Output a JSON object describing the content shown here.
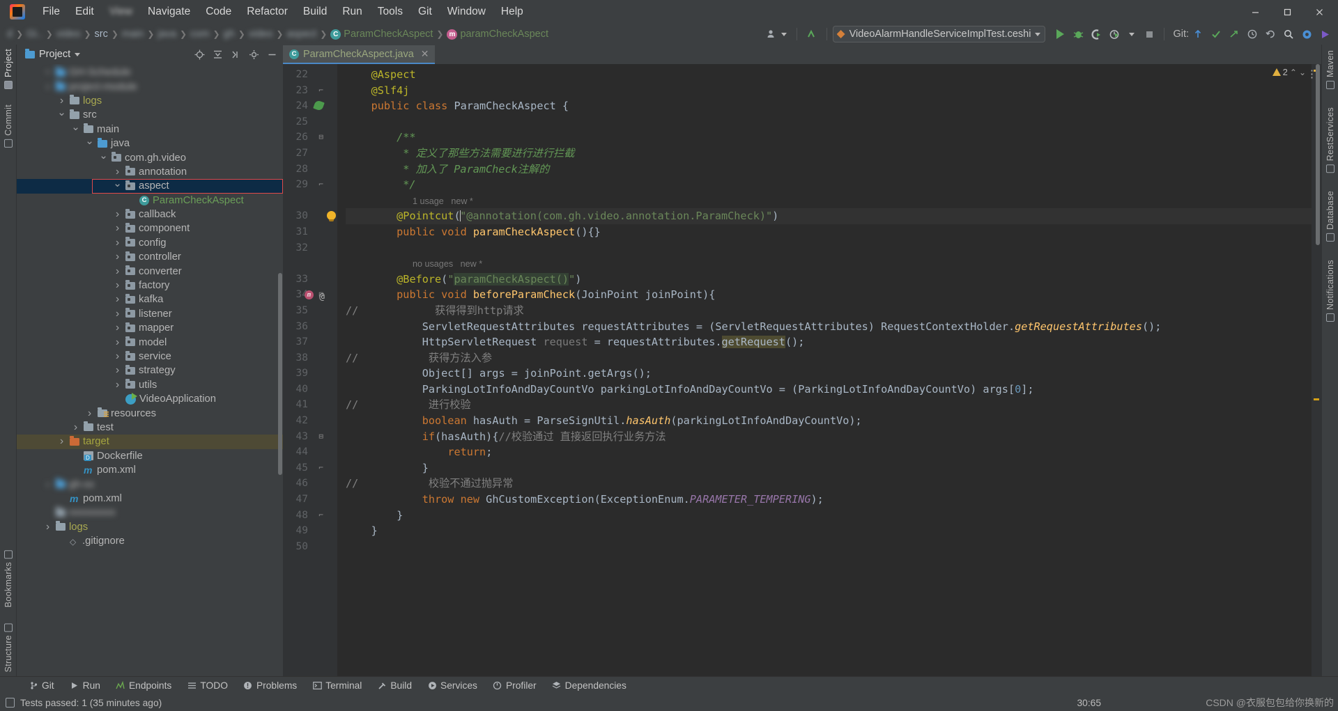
{
  "window": {
    "minimize": "—",
    "maximize": "▢",
    "close": "✕"
  },
  "menubar": {
    "items": [
      {
        "label": "File",
        "blurred": false
      },
      {
        "label": "Edit",
        "blurred": false
      },
      {
        "label": "View",
        "blurred": true
      },
      {
        "label": "Navigate",
        "blurred": false
      },
      {
        "label": "Code",
        "blurred": false
      },
      {
        "label": "Refactor",
        "blurred": false
      },
      {
        "label": "Build",
        "blurred": false
      },
      {
        "label": "Run",
        "blurred": false
      },
      {
        "label": "Tools",
        "blurred": false
      },
      {
        "label": "Git",
        "blurred": false
      },
      {
        "label": "Window",
        "blurred": false
      },
      {
        "label": "Help",
        "blurred": false
      }
    ]
  },
  "navbar": {
    "breadcrumbs": [
      {
        "label": "d",
        "blurred": true
      },
      {
        "label": "Gi..",
        "blurred": true
      },
      {
        "label": "video",
        "blurred": true
      },
      {
        "label": "src",
        "blurred": false
      },
      {
        "label": "main",
        "blurred": true
      },
      {
        "label": "java",
        "blurred": true
      },
      {
        "label": "com",
        "blurred": true
      },
      {
        "label": "gh",
        "blurred": true
      },
      {
        "label": "video",
        "blurred": true
      },
      {
        "label": "aspect",
        "blurred": true
      }
    ],
    "class_crumb": "ParamCheckAspect",
    "method_crumb": "paramCheckAspect",
    "run_config": "VideoAlarmHandleServiceImplTest.ceshi",
    "git_label": "Git:",
    "icons": {
      "profile": "user-group-icon",
      "back": "navigate-back-icon",
      "run": "run-icon",
      "debug": "debug-icon",
      "run_coverage": "run-with-coverage-icon",
      "profiler": "profiler-icon",
      "stop": "stop-icon",
      "git_update": "git-update-icon",
      "git_commit": "git-commit-icon",
      "git_push": "git-push-icon",
      "history": "history-icon",
      "undo": "undo-icon",
      "search": "search-icon",
      "settings": "settings-icon",
      "play_big": "play-icon"
    }
  },
  "left_rail": {
    "top": [
      {
        "label": "Project",
        "icon": "project-icon",
        "active": true
      },
      {
        "label": "Commit",
        "icon": "commit-icon",
        "active": false
      }
    ],
    "bottom": [
      {
        "label": "Bookmarks",
        "icon": "bookmarks-icon"
      },
      {
        "label": "Structure",
        "icon": "structure-icon"
      }
    ]
  },
  "right_rail": {
    "items": [
      {
        "label": "Maven",
        "icon": "maven-icon"
      },
      {
        "label": "RestServices",
        "icon": "rest-services-icon"
      },
      {
        "label": "Database",
        "icon": "database-icon"
      },
      {
        "label": "Notifications",
        "icon": "notifications-icon"
      }
    ]
  },
  "project_panel": {
    "title": "Project",
    "toolbar_icons": [
      "locate-icon",
      "collapse-all-icon",
      "expand-icon",
      "settings-icon",
      "hide-icon"
    ],
    "tree": [
      {
        "indent": 1,
        "arrow": "down",
        "icon": "module-icon",
        "label": "GH-Schedule",
        "style": "blur",
        "blurred": true
      },
      {
        "indent": 1,
        "arrow": "right",
        "icon": "module-icon",
        "label": "project-module",
        "style": "blur",
        "blurred": true
      },
      {
        "indent": 2,
        "arrow": "right",
        "icon": "folder",
        "label": "logs",
        "style": "yellowish"
      },
      {
        "indent": 2,
        "arrow": "down",
        "icon": "folder",
        "label": "src",
        "style": "plain"
      },
      {
        "indent": 3,
        "arrow": "down",
        "icon": "folder",
        "label": "main",
        "style": "plain"
      },
      {
        "indent": 4,
        "arrow": "down",
        "icon": "folder-blue",
        "label": "java",
        "style": "plain"
      },
      {
        "indent": 5,
        "arrow": "down",
        "icon": "package",
        "label": "com.gh.video",
        "style": "plain"
      },
      {
        "indent": 6,
        "arrow": "right",
        "icon": "package",
        "label": "annotation",
        "style": "plain"
      },
      {
        "indent": 6,
        "arrow": "down",
        "icon": "package",
        "label": "aspect",
        "style": "plain",
        "selected": "aspect"
      },
      {
        "indent": 7,
        "arrow": "none",
        "icon": "class",
        "label": "ParamCheckAspect",
        "style": "green"
      },
      {
        "indent": 6,
        "arrow": "right",
        "icon": "package",
        "label": "callback",
        "style": "plain"
      },
      {
        "indent": 6,
        "arrow": "right",
        "icon": "package",
        "label": "component",
        "style": "plain"
      },
      {
        "indent": 6,
        "arrow": "right",
        "icon": "package",
        "label": "config",
        "style": "plain"
      },
      {
        "indent": 6,
        "arrow": "right",
        "icon": "package",
        "label": "controller",
        "style": "plain"
      },
      {
        "indent": 6,
        "arrow": "right",
        "icon": "package",
        "label": "converter",
        "style": "plain"
      },
      {
        "indent": 6,
        "arrow": "right",
        "icon": "package",
        "label": "factory",
        "style": "plain"
      },
      {
        "indent": 6,
        "arrow": "right",
        "icon": "package",
        "label": "kafka",
        "style": "plain"
      },
      {
        "indent": 6,
        "arrow": "right",
        "icon": "package",
        "label": "listener",
        "style": "plain"
      },
      {
        "indent": 6,
        "arrow": "right",
        "icon": "package",
        "label": "mapper",
        "style": "plain"
      },
      {
        "indent": 6,
        "arrow": "right",
        "icon": "package",
        "label": "model",
        "style": "plain"
      },
      {
        "indent": 6,
        "arrow": "right",
        "icon": "package",
        "label": "service",
        "style": "plain"
      },
      {
        "indent": 6,
        "arrow": "right",
        "icon": "package",
        "label": "strategy",
        "style": "plain"
      },
      {
        "indent": 6,
        "arrow": "right",
        "icon": "package",
        "label": "utils",
        "style": "plain"
      },
      {
        "indent": 6,
        "arrow": "none",
        "icon": "spring",
        "label": "VideoApplication",
        "style": "plain"
      },
      {
        "indent": 4,
        "arrow": "right",
        "icon": "resources",
        "label": "resources",
        "style": "plain"
      },
      {
        "indent": 3,
        "arrow": "right",
        "icon": "folder",
        "label": "test",
        "style": "plain"
      },
      {
        "indent": 2,
        "arrow": "right",
        "icon": "folder-orange",
        "label": "target",
        "style": "olive",
        "selected": "target"
      },
      {
        "indent": 3,
        "arrow": "none",
        "icon": "docker",
        "label": "Dockerfile",
        "style": "plain"
      },
      {
        "indent": 3,
        "arrow": "none",
        "icon": "maven",
        "label": "pom.xml",
        "style": "plain"
      },
      {
        "indent": 1,
        "arrow": "right",
        "icon": "module-icon",
        "label": "gh-xx",
        "style": "blur",
        "blurred": true
      },
      {
        "indent": 2,
        "arrow": "none",
        "icon": "maven",
        "label": "pom.xml",
        "style": "plain"
      },
      {
        "indent": 1,
        "arrow": "none",
        "icon": "blurmod",
        "label": "xxxxxxxxx",
        "style": "blur",
        "blurred": true
      },
      {
        "indent": 1,
        "arrow": "right",
        "icon": "folder",
        "label": "logs",
        "style": "yellowish"
      },
      {
        "indent": 2,
        "arrow": "none",
        "icon": "git",
        "label": ".gitignore",
        "style": "plain"
      }
    ]
  },
  "editor": {
    "tab": {
      "label": "ParamCheckAspect.java",
      "icon": "java-class-icon",
      "close": "✕"
    },
    "warning_count": "2",
    "first_line": 22,
    "caret_position": "30:65",
    "lines": [
      {
        "n": 22,
        "fold": "",
        "gutter": "",
        "tokens": [
          {
            "t": "    ",
            "c": "txt"
          },
          {
            "t": "@Aspect",
            "c": "ann"
          }
        ]
      },
      {
        "n": 23,
        "fold": "end-brace",
        "gutter": "",
        "tokens": [
          {
            "t": "    ",
            "c": "txt"
          },
          {
            "t": "@Slf4j",
            "c": "ann"
          }
        ]
      },
      {
        "n": 24,
        "fold": "",
        "gutter": "bean",
        "tokens": [
          {
            "t": "    ",
            "c": "txt"
          },
          {
            "t": "public class ",
            "c": "kw"
          },
          {
            "t": "ParamCheckAspect ",
            "c": "txt"
          },
          {
            "t": "{",
            "c": "txt"
          }
        ]
      },
      {
        "n": 25,
        "fold": "",
        "gutter": "",
        "tokens": []
      },
      {
        "n": 26,
        "fold": "start",
        "gutter": "",
        "tokens": [
          {
            "t": "        /**",
            "c": "cmt"
          }
        ]
      },
      {
        "n": 27,
        "fold": "",
        "gutter": "",
        "tokens": [
          {
            "t": "         * 定义了那些方法需要进行进行拦截",
            "c": "cmt"
          }
        ]
      },
      {
        "n": 28,
        "fold": "",
        "gutter": "",
        "tokens": [
          {
            "t": "         * 加入了 ParamCheck注解的",
            "c": "cmt"
          }
        ]
      },
      {
        "n": 29,
        "fold": "end",
        "gutter": "",
        "tokens": [
          {
            "t": "         */",
            "c": "cmt"
          }
        ]
      },
      {
        "n": "",
        "fold": "",
        "gutter": "",
        "hint": "1 usage   new *"
      },
      {
        "n": 30,
        "fold": "",
        "gutter": "bulb",
        "highlight": true,
        "tokens": [
          {
            "t": "        ",
            "c": "txt"
          },
          {
            "t": "@Pointcut",
            "c": "ann"
          },
          {
            "t": "(",
            "c": "txt"
          },
          {
            "t": "|",
            "c": "caret"
          },
          {
            "t": "\"@annotation(com.gh.video.annotation.ParamCheck)\"",
            "c": "str"
          },
          {
            "t": ")",
            "c": "txt"
          }
        ]
      },
      {
        "n": 31,
        "fold": "",
        "gutter": "",
        "tokens": [
          {
            "t": "        ",
            "c": "txt"
          },
          {
            "t": "public void ",
            "c": "kw"
          },
          {
            "t": "paramCheckAspect",
            "c": "meth"
          },
          {
            "t": "(){}",
            "c": "txt"
          }
        ]
      },
      {
        "n": 32,
        "fold": "",
        "gutter": "",
        "tokens": []
      },
      {
        "n": "",
        "fold": "",
        "gutter": "",
        "hint": "no usages   new *"
      },
      {
        "n": 33,
        "fold": "",
        "gutter": "",
        "tokens": [
          {
            "t": "        ",
            "c": "txt"
          },
          {
            "t": "@Before",
            "c": "ann"
          },
          {
            "t": "(",
            "c": "txt"
          },
          {
            "t": "\"",
            "c": "str"
          },
          {
            "t": "paramCheckAspect()",
            "c": "str sel-g"
          },
          {
            "t": "\"",
            "c": "str"
          },
          {
            "t": ")",
            "c": "txt"
          }
        ]
      },
      {
        "n": 34,
        "fold": "start",
        "gutter": "method-override",
        "tokens": [
          {
            "t": "        ",
            "c": "txt"
          },
          {
            "t": "public void ",
            "c": "kw"
          },
          {
            "t": "beforeParamCheck",
            "c": "meth"
          },
          {
            "t": "(",
            "c": "txt"
          },
          {
            "t": "JoinPoint joinPoint",
            "c": "txt"
          },
          {
            "t": "){",
            "c": "txt"
          }
        ]
      },
      {
        "n": 35,
        "fold": "",
        "gutter": "",
        "comment_slash": true,
        "tokens": [
          {
            "t": "            获得得到http请求",
            "c": "lcmt"
          }
        ]
      },
      {
        "n": 36,
        "fold": "",
        "gutter": "",
        "tokens": [
          {
            "t": "            ServletRequestAttributes requestAttributes = (ServletRequestAttributes) RequestContextHolder.",
            "c": "txt"
          },
          {
            "t": "getRequestAttributes",
            "c": "smeth"
          },
          {
            "t": "();",
            "c": "txt"
          }
        ]
      },
      {
        "n": 37,
        "fold": "",
        "gutter": "",
        "tokens": [
          {
            "t": "            HttpServletRequest ",
            "c": "txt"
          },
          {
            "t": "request",
            "c": "par"
          },
          {
            "t": " = requestAttributes.",
            "c": "txt"
          },
          {
            "t": "getRequest",
            "c": "txt sel-y"
          },
          {
            "t": "()",
            "c": "txt"
          },
          {
            "t": ";",
            "c": "txt"
          }
        ]
      },
      {
        "n": 38,
        "fold": "",
        "gutter": "",
        "comment_slash": true,
        "tokens": [
          {
            "t": "           获得方法入参",
            "c": "lcmt"
          }
        ]
      },
      {
        "n": 39,
        "fold": "",
        "gutter": "",
        "tokens": [
          {
            "t": "            Object[] args = joinPoint.getArgs",
            "c": "txt"
          },
          {
            "t": "();",
            "c": "txt"
          }
        ]
      },
      {
        "n": 40,
        "fold": "",
        "gutter": "",
        "tokens": [
          {
            "t": "            ParkingLotInfoAndDayCountVo parkingLotInfoAndDayCountVo = (ParkingLotInfoAndDayCountVo) args[",
            "c": "txt"
          },
          {
            "t": "0",
            "c": "num"
          },
          {
            "t": "];",
            "c": "txt"
          }
        ]
      },
      {
        "n": 41,
        "fold": "",
        "gutter": "",
        "comment_slash": true,
        "tokens": [
          {
            "t": "           进行校验",
            "c": "lcmt"
          }
        ]
      },
      {
        "n": 42,
        "fold": "",
        "gutter": "",
        "tokens": [
          {
            "t": "            ",
            "c": "txt"
          },
          {
            "t": "boolean ",
            "c": "kw"
          },
          {
            "t": "hasAuth = ParseSignUtil.",
            "c": "txt"
          },
          {
            "t": "hasAuth",
            "c": "smeth"
          },
          {
            "t": "(parkingLotInfoAndDayCountVo);",
            "c": "txt"
          }
        ]
      },
      {
        "n": 43,
        "fold": "start",
        "gutter": "",
        "tokens": [
          {
            "t": "            ",
            "c": "txt"
          },
          {
            "t": "if",
            "c": "kw"
          },
          {
            "t": "(hasAuth){",
            "c": "txt"
          },
          {
            "t": "//校验通过 直接返回执行业务方法",
            "c": "lcmt"
          }
        ]
      },
      {
        "n": 44,
        "fold": "",
        "gutter": "",
        "tokens": [
          {
            "t": "                ",
            "c": "txt"
          },
          {
            "t": "return",
            "c": "kw"
          },
          {
            "t": ";",
            "c": "txt"
          }
        ]
      },
      {
        "n": 45,
        "fold": "end",
        "gutter": "",
        "tokens": [
          {
            "t": "            }",
            "c": "txt"
          }
        ]
      },
      {
        "n": 46,
        "fold": "",
        "gutter": "",
        "comment_slash": true,
        "tokens": [
          {
            "t": "           校验不通过抛异常",
            "c": "lcmt"
          }
        ]
      },
      {
        "n": 47,
        "fold": "",
        "gutter": "",
        "tokens": [
          {
            "t": "            ",
            "c": "txt"
          },
          {
            "t": "throw new ",
            "c": "kw"
          },
          {
            "t": "GhCustomException(ExceptionEnum.",
            "c": "txt"
          },
          {
            "t": "PARAMETER_TEMPERING",
            "c": "sfield"
          },
          {
            "t": ");",
            "c": "txt"
          }
        ]
      },
      {
        "n": 48,
        "fold": "end",
        "gutter": "",
        "tokens": [
          {
            "t": "        }",
            "c": "txt"
          }
        ]
      },
      {
        "n": 49,
        "fold": "",
        "gutter": "",
        "tokens": [
          {
            "t": "    }",
            "c": "txt"
          }
        ]
      },
      {
        "n": 50,
        "fold": "",
        "gutter": "",
        "tokens": []
      }
    ]
  },
  "toolwindows": [
    {
      "label": "Git",
      "icon": "git-branch-icon"
    },
    {
      "label": "Run",
      "icon": "run-icon"
    },
    {
      "label": "Endpoints",
      "icon": "endpoints-icon"
    },
    {
      "label": "TODO",
      "icon": "todo-list-icon"
    },
    {
      "label": "Problems",
      "icon": "problems-icon"
    },
    {
      "label": "Terminal",
      "icon": "terminal-icon"
    },
    {
      "label": "Build",
      "icon": "build-hammer-icon"
    },
    {
      "label": "Services",
      "icon": "services-icon"
    },
    {
      "label": "Profiler",
      "icon": "profiler-icon"
    },
    {
      "label": "Dependencies",
      "icon": "dependencies-icon"
    }
  ],
  "statusbar": {
    "message": "Tests passed: 1 (35 minutes ago)",
    "position": "30:65",
    "watermark": "CSDN @衣服包包给你换新的"
  },
  "colors": {
    "accent_blue": "#4a88c7",
    "selection_blue": "#0d2b45",
    "highlight_red": "#e04a4a",
    "target_olive": "#4e4a35",
    "editor_bg": "#2b2b2b",
    "panel_bg": "#3c3f41",
    "gutter_bg": "#313335"
  }
}
